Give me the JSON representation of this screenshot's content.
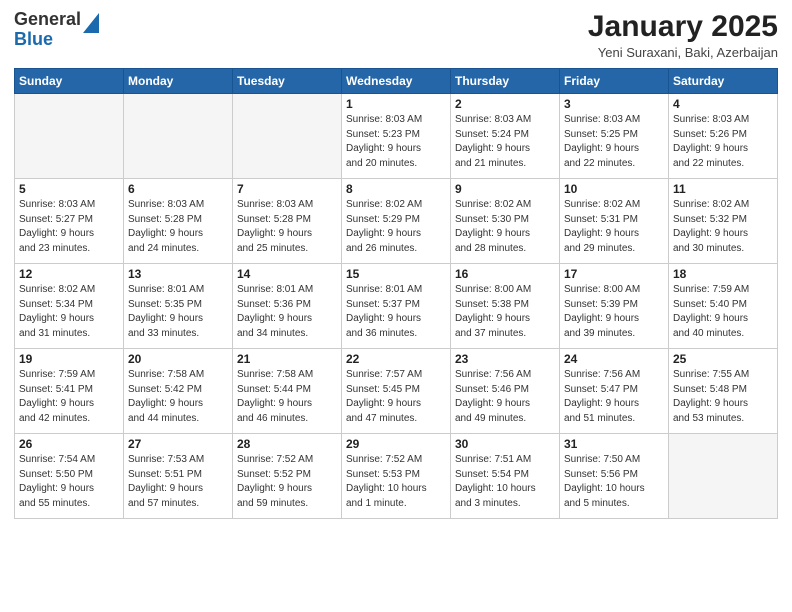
{
  "header": {
    "logo_general": "General",
    "logo_blue": "Blue",
    "month_title": "January 2025",
    "location": "Yeni Suraxani, Baki, Azerbaijan"
  },
  "days_of_week": [
    "Sunday",
    "Monday",
    "Tuesday",
    "Wednesday",
    "Thursday",
    "Friday",
    "Saturday"
  ],
  "weeks": [
    [
      {
        "day": "",
        "info": ""
      },
      {
        "day": "",
        "info": ""
      },
      {
        "day": "",
        "info": ""
      },
      {
        "day": "1",
        "info": "Sunrise: 8:03 AM\nSunset: 5:23 PM\nDaylight: 9 hours\nand 20 minutes."
      },
      {
        "day": "2",
        "info": "Sunrise: 8:03 AM\nSunset: 5:24 PM\nDaylight: 9 hours\nand 21 minutes."
      },
      {
        "day": "3",
        "info": "Sunrise: 8:03 AM\nSunset: 5:25 PM\nDaylight: 9 hours\nand 22 minutes."
      },
      {
        "day": "4",
        "info": "Sunrise: 8:03 AM\nSunset: 5:26 PM\nDaylight: 9 hours\nand 22 minutes."
      }
    ],
    [
      {
        "day": "5",
        "info": "Sunrise: 8:03 AM\nSunset: 5:27 PM\nDaylight: 9 hours\nand 23 minutes."
      },
      {
        "day": "6",
        "info": "Sunrise: 8:03 AM\nSunset: 5:28 PM\nDaylight: 9 hours\nand 24 minutes."
      },
      {
        "day": "7",
        "info": "Sunrise: 8:03 AM\nSunset: 5:28 PM\nDaylight: 9 hours\nand 25 minutes."
      },
      {
        "day": "8",
        "info": "Sunrise: 8:02 AM\nSunset: 5:29 PM\nDaylight: 9 hours\nand 26 minutes."
      },
      {
        "day": "9",
        "info": "Sunrise: 8:02 AM\nSunset: 5:30 PM\nDaylight: 9 hours\nand 28 minutes."
      },
      {
        "day": "10",
        "info": "Sunrise: 8:02 AM\nSunset: 5:31 PM\nDaylight: 9 hours\nand 29 minutes."
      },
      {
        "day": "11",
        "info": "Sunrise: 8:02 AM\nSunset: 5:32 PM\nDaylight: 9 hours\nand 30 minutes."
      }
    ],
    [
      {
        "day": "12",
        "info": "Sunrise: 8:02 AM\nSunset: 5:34 PM\nDaylight: 9 hours\nand 31 minutes."
      },
      {
        "day": "13",
        "info": "Sunrise: 8:01 AM\nSunset: 5:35 PM\nDaylight: 9 hours\nand 33 minutes."
      },
      {
        "day": "14",
        "info": "Sunrise: 8:01 AM\nSunset: 5:36 PM\nDaylight: 9 hours\nand 34 minutes."
      },
      {
        "day": "15",
        "info": "Sunrise: 8:01 AM\nSunset: 5:37 PM\nDaylight: 9 hours\nand 36 minutes."
      },
      {
        "day": "16",
        "info": "Sunrise: 8:00 AM\nSunset: 5:38 PM\nDaylight: 9 hours\nand 37 minutes."
      },
      {
        "day": "17",
        "info": "Sunrise: 8:00 AM\nSunset: 5:39 PM\nDaylight: 9 hours\nand 39 minutes."
      },
      {
        "day": "18",
        "info": "Sunrise: 7:59 AM\nSunset: 5:40 PM\nDaylight: 9 hours\nand 40 minutes."
      }
    ],
    [
      {
        "day": "19",
        "info": "Sunrise: 7:59 AM\nSunset: 5:41 PM\nDaylight: 9 hours\nand 42 minutes."
      },
      {
        "day": "20",
        "info": "Sunrise: 7:58 AM\nSunset: 5:42 PM\nDaylight: 9 hours\nand 44 minutes."
      },
      {
        "day": "21",
        "info": "Sunrise: 7:58 AM\nSunset: 5:44 PM\nDaylight: 9 hours\nand 46 minutes."
      },
      {
        "day": "22",
        "info": "Sunrise: 7:57 AM\nSunset: 5:45 PM\nDaylight: 9 hours\nand 47 minutes."
      },
      {
        "day": "23",
        "info": "Sunrise: 7:56 AM\nSunset: 5:46 PM\nDaylight: 9 hours\nand 49 minutes."
      },
      {
        "day": "24",
        "info": "Sunrise: 7:56 AM\nSunset: 5:47 PM\nDaylight: 9 hours\nand 51 minutes."
      },
      {
        "day": "25",
        "info": "Sunrise: 7:55 AM\nSunset: 5:48 PM\nDaylight: 9 hours\nand 53 minutes."
      }
    ],
    [
      {
        "day": "26",
        "info": "Sunrise: 7:54 AM\nSunset: 5:50 PM\nDaylight: 9 hours\nand 55 minutes."
      },
      {
        "day": "27",
        "info": "Sunrise: 7:53 AM\nSunset: 5:51 PM\nDaylight: 9 hours\nand 57 minutes."
      },
      {
        "day": "28",
        "info": "Sunrise: 7:52 AM\nSunset: 5:52 PM\nDaylight: 9 hours\nand 59 minutes."
      },
      {
        "day": "29",
        "info": "Sunrise: 7:52 AM\nSunset: 5:53 PM\nDaylight: 10 hours\nand 1 minute."
      },
      {
        "day": "30",
        "info": "Sunrise: 7:51 AM\nSunset: 5:54 PM\nDaylight: 10 hours\nand 3 minutes."
      },
      {
        "day": "31",
        "info": "Sunrise: 7:50 AM\nSunset: 5:56 PM\nDaylight: 10 hours\nand 5 minutes."
      },
      {
        "day": "",
        "info": ""
      }
    ]
  ]
}
